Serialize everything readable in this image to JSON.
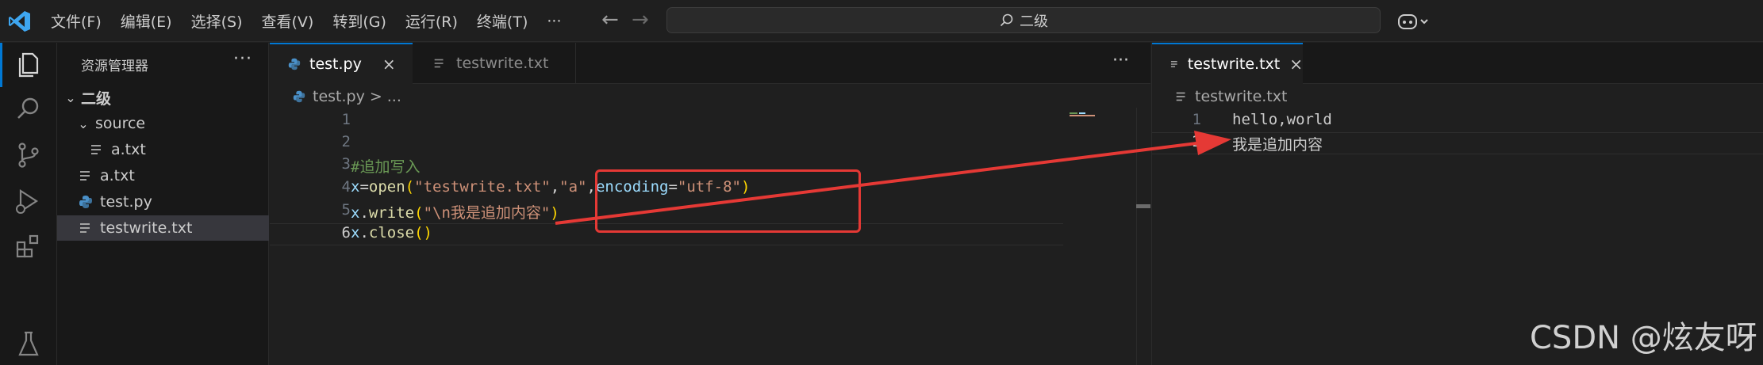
{
  "titlebar": {
    "menus": [
      "文件(F)",
      "编辑(E)",
      "选择(S)",
      "查看(V)",
      "转到(G)",
      "运行(R)",
      "终端(T)",
      "···"
    ],
    "search_text": "二级"
  },
  "sidebar": {
    "title": "资源管理器",
    "more": "···",
    "tree": [
      {
        "label": "二级",
        "kind": "folder-open"
      },
      {
        "label": "source",
        "kind": "folder-open"
      },
      {
        "label": "a.txt",
        "kind": "text-file"
      },
      {
        "label": "a.txt",
        "kind": "text-file"
      },
      {
        "label": "test.py",
        "kind": "python-file"
      },
      {
        "label": "testwrite.txt",
        "kind": "text-file",
        "selected": true
      }
    ]
  },
  "editor_left": {
    "tabs": [
      {
        "label": "test.py",
        "active": true,
        "close": "×"
      },
      {
        "label": "testwrite.txt",
        "active": false
      }
    ],
    "more": "···",
    "breadcrumb": {
      "file": "test.py",
      "sep": ">",
      "rest": "..."
    },
    "line_numbers": [
      "1",
      "2",
      "3",
      "4",
      "5",
      "6"
    ],
    "current_line": "6",
    "code": {
      "line3": {
        "comment": "#追加写入"
      },
      "line4": {
        "var": "x",
        "eq": "=",
        "fn": "open",
        "p1": "(",
        "s1": "\"testwrite.txt\"",
        "c1": ",",
        "s2": "\"a\"",
        "c2": ",",
        "kw": "encoding",
        "eq2": "=",
        "s3": "\"utf-8\"",
        "p2": ")"
      },
      "line5": {
        "var": "x",
        "dot": ".",
        "fn": "write",
        "p1": "(",
        "s1": "\"\\n我是追加内容\"",
        "p2": ")"
      },
      "line6": {
        "var": "x",
        "dot": ".",
        "fn": "close",
        "p": "()"
      }
    }
  },
  "editor_right": {
    "tab": {
      "label": "testwrite.txt",
      "close": "×"
    },
    "breadcrumb": "testwrite.txt",
    "line_numbers": [
      "1",
      "2"
    ],
    "lines": [
      "hello,world",
      "我是追加内容"
    ]
  },
  "watermark": "CSDN @炫友呀",
  "colors": {
    "annotation": "#e53935",
    "accent": "#0078d4"
  }
}
